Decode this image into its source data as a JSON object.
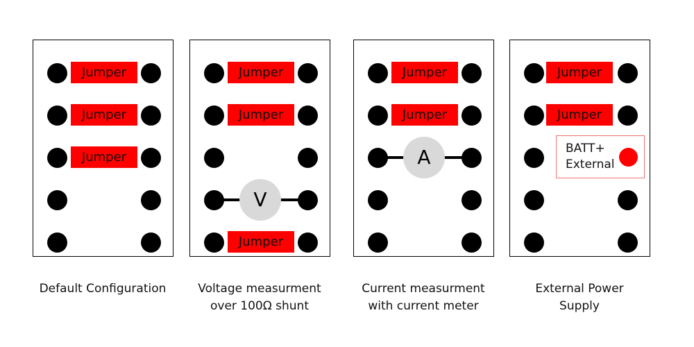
{
  "colors": {
    "jumper": "#fe0000",
    "pin": "#000000",
    "meter": "#d9d9d9",
    "external_dot": "#fe0000"
  },
  "panels": [
    {
      "caption_lines": [
        "Default Configuration"
      ],
      "jumpers": [
        {
          "row": 0,
          "label": "Jumper"
        },
        {
          "row": 1,
          "label": "Jumper"
        },
        {
          "row": 2,
          "label": "Jumper"
        }
      ]
    },
    {
      "caption_lines": [
        "Voltage measurment",
        "over 100Ω shunt"
      ],
      "jumpers": [
        {
          "row": 0,
          "label": "Jumper"
        },
        {
          "row": 1,
          "label": "Jumper"
        },
        {
          "row": 4,
          "label": "Jumper"
        }
      ],
      "meter": {
        "row": 3,
        "label": "V"
      }
    },
    {
      "caption_lines": [
        "Current measurment",
        "with current meter"
      ],
      "jumpers": [
        {
          "row": 0,
          "label": "Jumper"
        },
        {
          "row": 1,
          "label": "Jumper"
        }
      ],
      "meter": {
        "row": 2,
        "label": "A"
      }
    },
    {
      "caption_lines": [
        "External Power",
        "Supply"
      ],
      "jumpers": [
        {
          "row": 0,
          "label": "Jumper"
        },
        {
          "row": 1,
          "label": "Jumper"
        }
      ],
      "external": {
        "row": 2,
        "label_lines": [
          "BATT+",
          "External"
        ]
      }
    }
  ]
}
